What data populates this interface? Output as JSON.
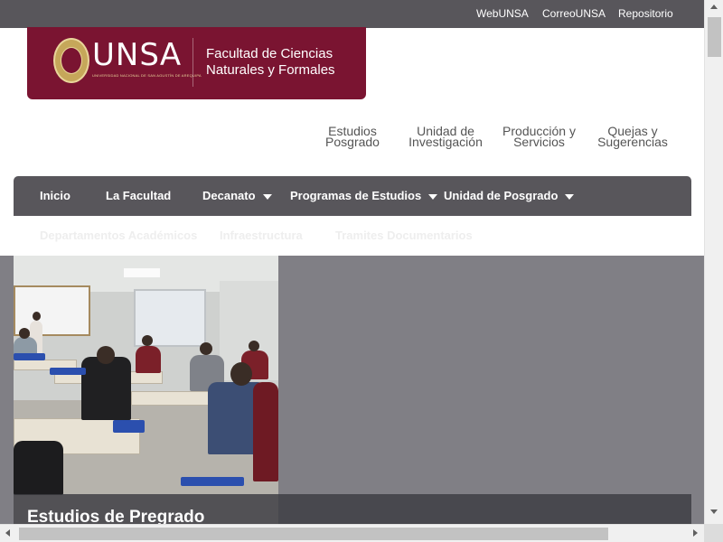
{
  "topbar": {
    "links": [
      "WebUNSA",
      "CorreoUNSA",
      "Repositorio"
    ]
  },
  "logo": {
    "brand": "UNSA",
    "brand_main": "UNS",
    "brand_accent": "A",
    "university_line": "UNIVERSIDAD NACIONAL DE SAN AGUSTÍN DE AREQUIPA",
    "faculty_line1": "Facultad de Ciencias",
    "faculty_line2": "Naturales y Formales"
  },
  "quick_links": [
    {
      "line1": "Estudios",
      "line2": "Posgrado"
    },
    {
      "line1": "Unidad de",
      "line2": "Investigación"
    },
    {
      "line1": "Producción y",
      "line2": "Servicios"
    },
    {
      "line1": "Quejas y",
      "line2": "Sugerencias"
    }
  ],
  "nav": {
    "items": [
      "Inicio",
      "La Facultad",
      "Decanato",
      "Programas de Estudios",
      "Unidad de Posgrado"
    ],
    "sub_items": [
      "Departamentos Académicos",
      "Infraestructura",
      "Tramites Documentarios"
    ]
  },
  "hero": {
    "caption": "Estudios de Pregrado"
  },
  "colors": {
    "brand": "#7a1431",
    "topbar": "#58565b",
    "nav": "#58565b",
    "hero_bg": "#807f85"
  }
}
